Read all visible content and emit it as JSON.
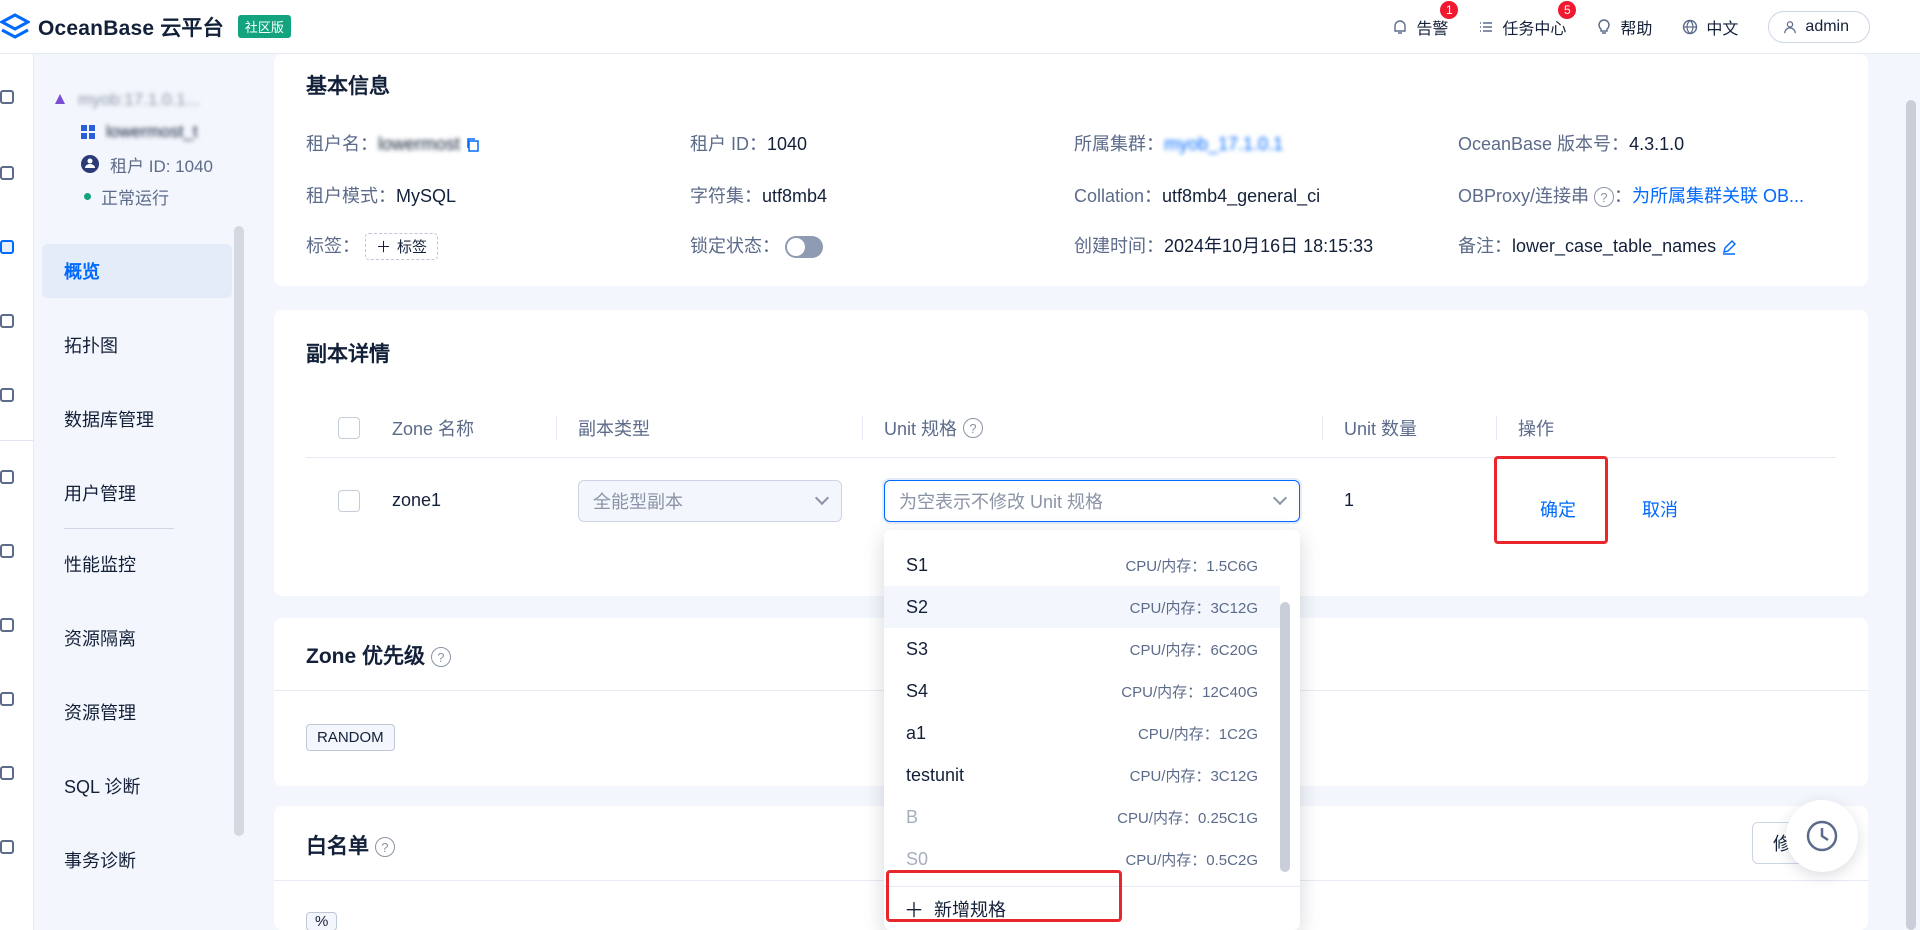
{
  "header": {
    "brand": "OceanBase 云平台",
    "edition": "社区版",
    "alerts": {
      "label": "告警",
      "count": "1"
    },
    "tasks": {
      "label": "任务中心",
      "count": "5"
    },
    "help": "帮助",
    "language": "中文",
    "user": "admin"
  },
  "sidebar": {
    "cluster_name": "myob:17.1.0.1...",
    "tenant_name": "lowermost_t",
    "tenant_id": "租户 ID: 1040",
    "status": "正常运行",
    "items": [
      {
        "label": "概览"
      },
      {
        "label": "拓扑图"
      },
      {
        "label": "数据库管理"
      },
      {
        "label": "用户管理"
      },
      {
        "label": "性能监控"
      },
      {
        "label": "资源隔离"
      },
      {
        "label": "资源管理"
      },
      {
        "label": "SQL 诊断"
      },
      {
        "label": "事务诊断"
      }
    ]
  },
  "basic_info": {
    "title": "基本信息",
    "tenant_name_label": "租户名：",
    "tenant_name_value": "lowermost",
    "tenant_id_label": "租户 ID：",
    "tenant_id_value": "1040",
    "cluster_label": "所属集群：",
    "cluster_value": "myob_17.1.0.1",
    "version_label": "OceanBase 版本号：",
    "version_value": "4.3.1.0",
    "mode_label": "租户模式：",
    "mode_value": "MySQL",
    "charset_label": "字符集：",
    "charset_value": "utf8mb4",
    "collation_label": "Collation：",
    "collation_value": "utf8mb4_general_ci",
    "obproxy_label": "OBProxy/连接串",
    "obproxy_value": "为所属集群关联 OB...",
    "tag_label": "标签：",
    "tag_button": "标签",
    "lock_label": "锁定状态：",
    "created_label": "创建时间：",
    "created_value": "2024年10月16日 18:15:33",
    "remark_label": "备注：",
    "remark_value": "lower_case_table_names"
  },
  "replica": {
    "title": "副本详情",
    "columns": [
      "Zone 名称",
      "副本类型",
      "Unit 规格",
      "Unit 数量",
      "操作"
    ],
    "row": {
      "zone": "zone1",
      "replica_type": "全能型副本",
      "unit_spec_placeholder": "为空表示不修改 Unit 规格",
      "unit_count": "1",
      "confirm": "确定",
      "cancel": "取消"
    }
  },
  "unit_dropdown": {
    "options": [
      {
        "name": "S1",
        "spec": "CPU/内存：1.5C6G"
      },
      {
        "name": "S2",
        "spec": "CPU/内存：3C12G"
      },
      {
        "name": "S3",
        "spec": "CPU/内存：6C20G"
      },
      {
        "name": "S4",
        "spec": "CPU/内存：12C40G"
      },
      {
        "name": "a1",
        "spec": "CPU/内存：1C2G"
      },
      {
        "name": "testunit",
        "spec": "CPU/内存：3C12G"
      },
      {
        "name": "B",
        "spec": "CPU/内存：0.25C1G"
      },
      {
        "name": "S0",
        "spec": "CPU/内存：0.5C2G"
      }
    ],
    "add_label": "新增规格"
  },
  "zone_priority": {
    "title": "Zone 优先级",
    "value": "RANDOM"
  },
  "whitelist": {
    "title": "白名单",
    "edit_label": "修",
    "entry": "%"
  },
  "colors": {
    "accent": "#006aff",
    "danger": "#e8262b",
    "success": "#14a37f"
  }
}
